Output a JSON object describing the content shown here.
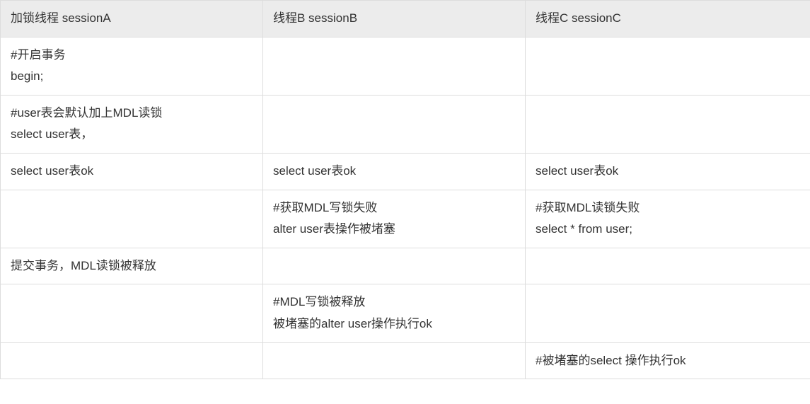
{
  "chart_data": {
    "type": "table",
    "title": "",
    "columns": [
      "加锁线程 sessionA",
      "线程B sessionB",
      "线程C sessionC"
    ],
    "rows": [
      {
        "a": "#开启事务\nbegin;",
        "b": "",
        "c": ""
      },
      {
        "a": "#user表会默认加上MDL读锁\nselect user表，",
        "b": "",
        "c": ""
      },
      {
        "a": "select user表ok",
        "b": "select user表ok",
        "c": "select user表ok"
      },
      {
        "a": "",
        "b": "#获取MDL写锁失败\nalter user表操作被堵塞",
        "c": "#获取MDL读锁失败\nselect * from user;"
      },
      {
        "a": "提交事务，MDL读锁被释放",
        "b": "",
        "c": ""
      },
      {
        "a": "",
        "b": "#MDL写锁被释放\n被堵塞的alter user操作执行ok",
        "c": ""
      },
      {
        "a": "",
        "b": "",
        "c": "#被堵塞的select 操作执行ok"
      }
    ]
  }
}
